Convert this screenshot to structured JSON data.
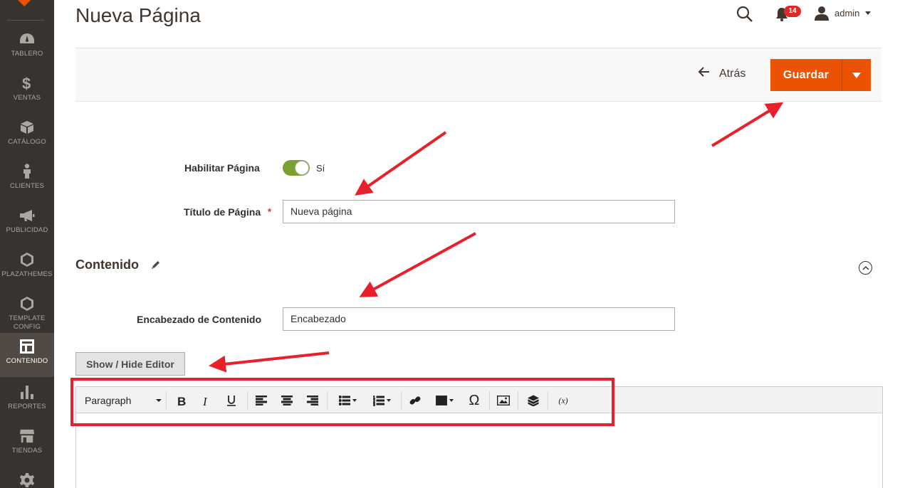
{
  "sidebar": {
    "items": [
      {
        "label": "TABLERO",
        "icon": "dashboard-icon"
      },
      {
        "label": "VENTAS",
        "icon": "dollar-icon"
      },
      {
        "label": "CATÁLOGO",
        "icon": "box-icon"
      },
      {
        "label": "CLIENTES",
        "icon": "person-icon"
      },
      {
        "label": "PUBLICIDAD",
        "icon": "megaphone-icon"
      },
      {
        "label": "PLAZATHEMES",
        "icon": "hexagon-icon"
      },
      {
        "label": "TEMPLATE CONFIG",
        "icon": "hexagon-icon"
      },
      {
        "label": "CONTENIDO",
        "icon": "layout-icon",
        "active": true
      },
      {
        "label": "REPORTES",
        "icon": "bar-chart-icon"
      },
      {
        "label": "TIENDAS",
        "icon": "store-icon"
      }
    ]
  },
  "header": {
    "title": "Nueva Página",
    "notification_count": "14",
    "user_name": "admin"
  },
  "actions": {
    "back_label": "Atrás",
    "save_label": "Guardar"
  },
  "form": {
    "enable_label": "Habilitar Página",
    "enable_state_label": "Sí",
    "enable_value": true,
    "title_label": "Título de Página",
    "title_required": "*",
    "title_value": "Nueva página",
    "section_title": "Contenido",
    "heading_label": "Encabezado de Contenido",
    "heading_value": "Encabezado",
    "show_hide_label": "Show / Hide Editor"
  },
  "editor": {
    "format_select": "Paragraph",
    "tools": [
      "bold-icon",
      "italic-icon",
      "underline-icon",
      "align-left-icon",
      "align-center-icon",
      "align-right-icon",
      "bullet-list-icon",
      "numbered-list-icon",
      "link-icon",
      "table-icon",
      "omega-icon",
      "image-icon",
      "widget-icon",
      "variable-icon"
    ],
    "variable_glyph": "(x)",
    "omega_glyph": "Ω"
  },
  "colors": {
    "accent": "#eb5202",
    "sidebar_bg": "#373330",
    "toggle_on": "#79a22e",
    "annotation_red": "#e8202a"
  }
}
